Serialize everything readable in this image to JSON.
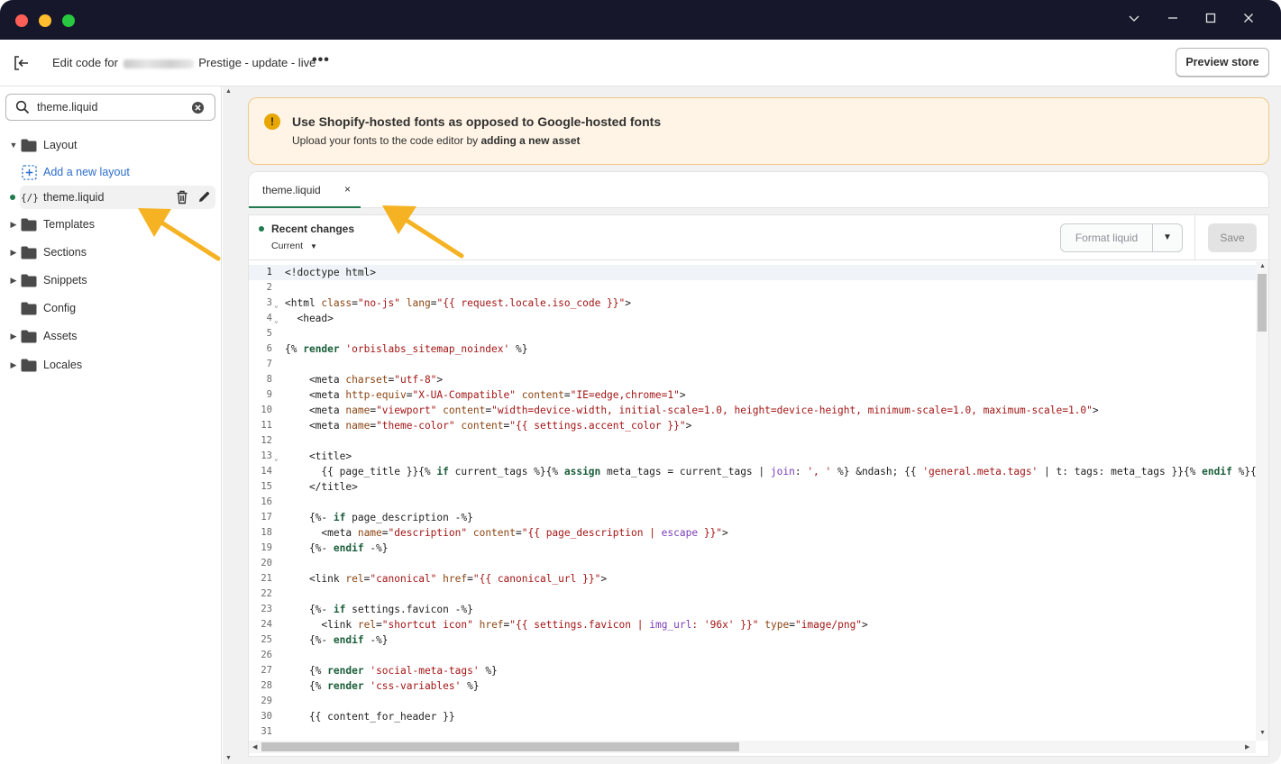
{
  "titlebar": {
    "window_controls": [
      "chevron-down-icon",
      "minimize-icon",
      "maximize-icon",
      "close-icon"
    ]
  },
  "header": {
    "title_prefix": "Edit code for",
    "title_suffix": "Prestige - update - live",
    "more": "•••",
    "preview_label": "Preview store"
  },
  "sidebar": {
    "search": {
      "value": "theme.liquid"
    },
    "folders": [
      {
        "label": "Layout",
        "expanded": true
      },
      {
        "label": "Templates",
        "expanded": false
      },
      {
        "label": "Sections",
        "expanded": false
      },
      {
        "label": "Snippets",
        "expanded": false
      },
      {
        "label": "Config",
        "expanded": false
      },
      {
        "label": "Assets",
        "expanded": false
      },
      {
        "label": "Locales",
        "expanded": false
      }
    ],
    "add_layout": "Add a new layout",
    "file": {
      "icon_text": "{/}",
      "label": "theme.liquid"
    }
  },
  "banner": {
    "icon": "!",
    "title": "Use Shopify-hosted fonts as opposed to Google-hosted fonts",
    "text_prefix": "Upload your fonts to the code editor by ",
    "text_bold": "adding a new asset"
  },
  "editor": {
    "tab": {
      "label": "theme.liquid",
      "close": "×"
    },
    "recent_changes": "Recent changes",
    "current": "Current",
    "format_label": "Format liquid",
    "save_label": "Save",
    "active_line": 1,
    "lines": [
      {
        "n": "1",
        "t": "<!doctype html>"
      },
      {
        "n": "2",
        "t": ""
      },
      {
        "n": "3",
        "t": "<html class=\"no-js\" lang=\"{{ request.locale.iso_code }}\">",
        "fold": true
      },
      {
        "n": "4",
        "t": "  <head>",
        "fold": true
      },
      {
        "n": "5",
        "t": ""
      },
      {
        "n": "6",
        "t": "{% render 'orbislabs_sitemap_noindex' %}"
      },
      {
        "n": "7",
        "t": ""
      },
      {
        "n": "8",
        "t": "    <meta charset=\"utf-8\">"
      },
      {
        "n": "9",
        "t": "    <meta http-equiv=\"X-UA-Compatible\" content=\"IE=edge,chrome=1\">"
      },
      {
        "n": "10",
        "t": "    <meta name=\"viewport\" content=\"width=device-width, initial-scale=1.0, height=device-height, minimum-scale=1.0, maximum-scale=1.0\">"
      },
      {
        "n": "11",
        "t": "    <meta name=\"theme-color\" content=\"{{ settings.accent_color }}\">"
      },
      {
        "n": "12",
        "t": ""
      },
      {
        "n": "13",
        "t": "    <title>",
        "fold": true
      },
      {
        "n": "14",
        "t": "      {{ page_title }}{% if current_tags %}{% assign meta_tags = current_tags | join: ', ' %} &ndash; {{ 'general.meta.tags' | t: tags: meta_tags }}{% endif %}{%"
      },
      {
        "n": "15",
        "t": "    </title>"
      },
      {
        "n": "16",
        "t": ""
      },
      {
        "n": "17",
        "t": "    {%- if page_description -%}"
      },
      {
        "n": "18",
        "t": "      <meta name=\"description\" content=\"{{ page_description | escape }}\">"
      },
      {
        "n": "19",
        "t": "    {%- endif -%}"
      },
      {
        "n": "20",
        "t": ""
      },
      {
        "n": "21",
        "t": "    <link rel=\"canonical\" href=\"{{ canonical_url }}\">"
      },
      {
        "n": "22",
        "t": ""
      },
      {
        "n": "23",
        "t": "    {%- if settings.favicon -%}"
      },
      {
        "n": "24",
        "t": "      <link rel=\"shortcut icon\" href=\"{{ settings.favicon | img_url: '96x' }}\" type=\"image/png\">"
      },
      {
        "n": "25",
        "t": "    {%- endif -%}"
      },
      {
        "n": "26",
        "t": ""
      },
      {
        "n": "27",
        "t": "    {% render 'social-meta-tags' %}"
      },
      {
        "n": "28",
        "t": "    {% render 'css-variables' %}"
      },
      {
        "n": "29",
        "t": ""
      },
      {
        "n": "30",
        "t": "    {{ content_for_header }}"
      },
      {
        "n": "31",
        "t": ""
      }
    ]
  },
  "colors": {
    "accent_green": "#1f7a4d",
    "annotation_arrow": "#f5b323",
    "titlebar_bg": "#16172b",
    "link_blue": "#2c6ecb"
  }
}
